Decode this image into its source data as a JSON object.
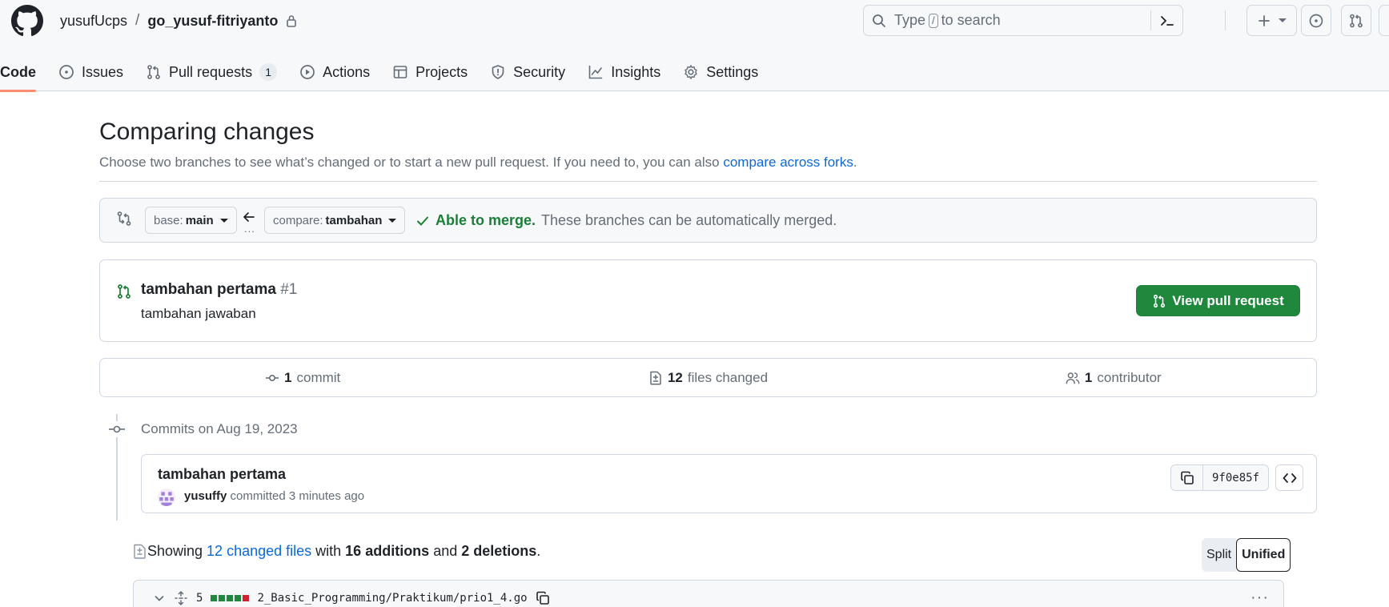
{
  "header": {
    "owner": "yusufUcps",
    "separator": "/",
    "repo": "go_yusuf-fitriyanto",
    "search": {
      "prefix": "Type",
      "key": "/",
      "suffix": "to search"
    }
  },
  "tabs": [
    {
      "label": "Code",
      "icon": "code-icon",
      "active": true
    },
    {
      "label": "Issues",
      "icon": "issue-opened-icon"
    },
    {
      "label": "Pull requests",
      "icon": "git-pull-request-icon",
      "count": "1"
    },
    {
      "label": "Actions",
      "icon": "play-icon"
    },
    {
      "label": "Projects",
      "icon": "table-icon"
    },
    {
      "label": "Security",
      "icon": "shield-icon"
    },
    {
      "label": "Insights",
      "icon": "graph-icon"
    },
    {
      "label": "Settings",
      "icon": "gear-icon"
    }
  ],
  "page": {
    "title": "Comparing changes",
    "description": "Choose two branches to see what’s changed or to start a new pull request. If you need to, you can also",
    "description_link": "compare across forks",
    "description_end": "."
  },
  "compare": {
    "base_label": "base:",
    "base_branch": "main",
    "compare_label": "compare:",
    "compare_branch": "tambahan",
    "dots": "...",
    "merge_ok": "Able to merge.",
    "merge_text": "These branches can be automatically merged."
  },
  "pull_request": {
    "title": "tambahan pertama",
    "number": "#1",
    "description": "tambahan jawaban",
    "button_label": "View pull request"
  },
  "stats": {
    "commits_count": "1",
    "commits_label": "commit",
    "files_count": "12",
    "files_label": "files changed",
    "contributors_count": "1",
    "contributors_label": "contributor"
  },
  "commits": {
    "date_heading": "Commits on Aug 19, 2023",
    "items": [
      {
        "title": "tambahan pertama",
        "author": "yusuffy",
        "action": "committed 3 minutes ago",
        "sha": "9f0e85f"
      }
    ]
  },
  "files_summary": {
    "prefix": "Showing",
    "changed_link": "12 changed files",
    "with": "with",
    "additions": "16 additions",
    "and": "and",
    "deletions": "2 deletions",
    "end": "."
  },
  "diff_view": {
    "split": "Split",
    "unified": "Unified",
    "selected": "Unified"
  },
  "file": {
    "changes": "5",
    "path": "2_Basic_Programming/Praktikum/prio1_4.go",
    "diffstat": [
      "added",
      "added",
      "added",
      "added",
      "deleted"
    ]
  },
  "colors": {
    "accent_green": "#1f883d",
    "link_blue": "#0969da",
    "tab_underline": "#fd8c73",
    "muted": "#656d76",
    "deleted_red": "#cf222e"
  }
}
